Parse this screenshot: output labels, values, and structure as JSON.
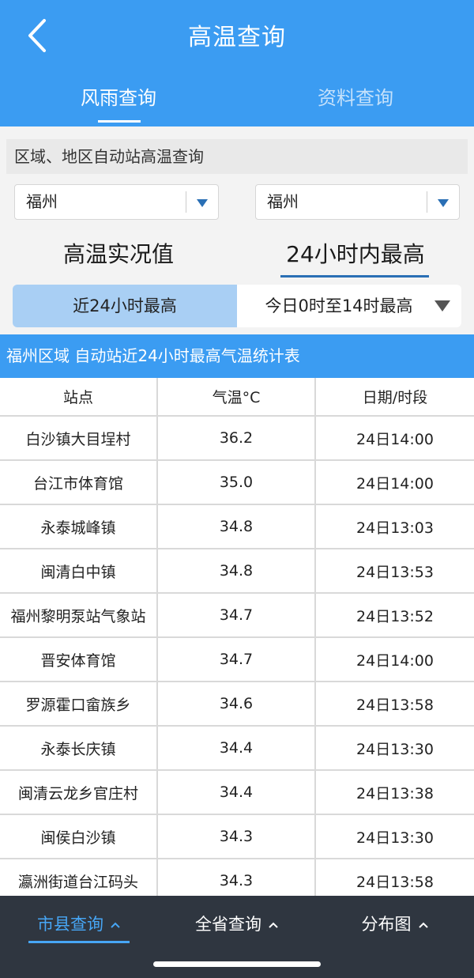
{
  "header": {
    "title": "高温查询",
    "tabs": [
      {
        "label": "风雨查询",
        "active": true
      },
      {
        "label": "资料查询",
        "active": false
      }
    ]
  },
  "query": {
    "section_label": "区域、地区自动站高温查询",
    "region_select": "福州",
    "station_select": "福州",
    "mode_tabs": [
      {
        "label": "高温实况值",
        "active": false
      },
      {
        "label": "24小时内最高",
        "active": true
      }
    ],
    "segments": [
      {
        "label": "近24小时最高",
        "active": true
      },
      {
        "label": "今日0时至14时最高",
        "active": false
      }
    ]
  },
  "table": {
    "caption": "福州区域 自动站近24小时最高气温统计表",
    "columns": [
      "站点",
      "气温°C",
      "日期/时段"
    ],
    "rows": [
      [
        "白沙镇大目埕村",
        "36.2",
        "24日14:00"
      ],
      [
        "台江市体育馆",
        "35.0",
        "24日14:00"
      ],
      [
        "永泰城峰镇",
        "34.8",
        "24日13:03"
      ],
      [
        "闽清白中镇",
        "34.8",
        "24日13:53"
      ],
      [
        "福州黎明泵站气象站",
        "34.7",
        "24日13:52"
      ],
      [
        "晋安体育馆",
        "34.7",
        "24日14:00"
      ],
      [
        "罗源霍口畲族乡",
        "34.6",
        "24日13:58"
      ],
      [
        "永泰长庆镇",
        "34.4",
        "24日13:30"
      ],
      [
        "闽清云龙乡官庄村",
        "34.4",
        "24日13:38"
      ],
      [
        "闽侯白沙镇",
        "34.3",
        "24日13:30"
      ],
      [
        "瀛洲街道台江码头",
        "34.3",
        "24日13:58"
      ]
    ]
  },
  "bottom_nav": {
    "items": [
      {
        "label": "市县查询",
        "active": true
      },
      {
        "label": "全省查询",
        "active": false
      },
      {
        "label": "分布图",
        "active": false
      }
    ]
  },
  "colors": {
    "accent": "#3b9cf2",
    "nav_active": "#47a6f5",
    "nav_bg": "#2f3640",
    "segment_active": "#a9cff4"
  },
  "icons": {
    "back": "chevron-left-icon",
    "dropdown": "triangle-down-icon",
    "nav_chevron": "chevron-up-icon"
  }
}
